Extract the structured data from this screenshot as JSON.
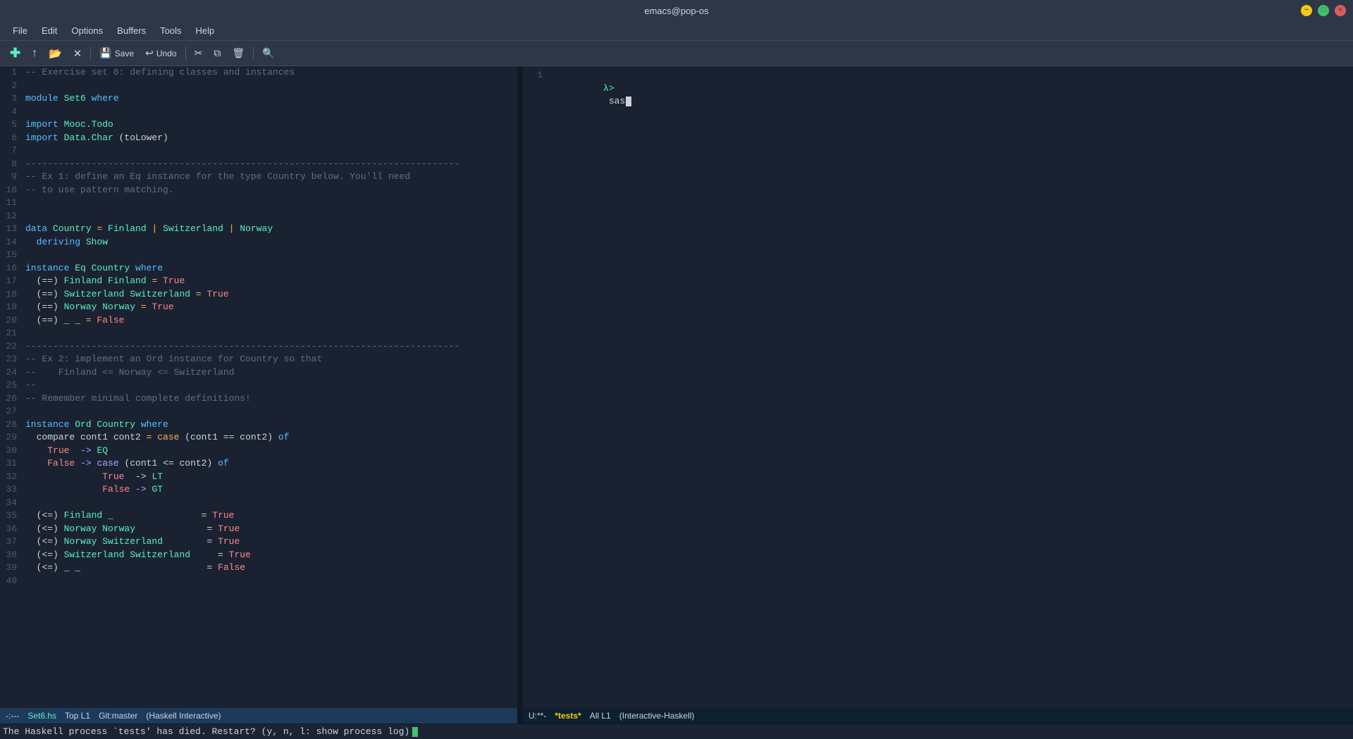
{
  "titlebar": {
    "title": "emacs@pop-os",
    "min_label": "−",
    "max_label": "□",
    "close_label": "×"
  },
  "menubar": {
    "items": [
      "File",
      "Edit",
      "Options",
      "Buffers",
      "Tools",
      "Help"
    ]
  },
  "toolbar": {
    "buttons": [
      {
        "id": "new",
        "icon": "✚",
        "label": ""
      },
      {
        "id": "open-file",
        "icon": "↑",
        "label": ""
      },
      {
        "id": "open",
        "icon": "📁",
        "label": ""
      },
      {
        "id": "close",
        "icon": "✕",
        "label": ""
      },
      {
        "id": "save",
        "icon": "💾",
        "label": "Save"
      },
      {
        "id": "undo",
        "icon": "↩",
        "label": "Undo"
      },
      {
        "id": "cut",
        "icon": "✂",
        "label": ""
      },
      {
        "id": "copy",
        "icon": "⧉",
        "label": ""
      },
      {
        "id": "paste",
        "icon": "🗑",
        "label": ""
      },
      {
        "id": "search",
        "icon": "🔍",
        "label": ""
      }
    ]
  },
  "editor": {
    "lines": [
      {
        "num": 1,
        "tokens": [
          {
            "t": "comment",
            "v": "-- Exercise set 6: defining classes and instances"
          }
        ]
      },
      {
        "num": 2,
        "tokens": []
      },
      {
        "num": 3,
        "tokens": [
          {
            "t": "kw",
            "v": "module"
          },
          {
            "t": "type",
            "v": " Set6"
          },
          {
            "t": "kw",
            "v": " where"
          }
        ]
      },
      {
        "num": 4,
        "tokens": []
      },
      {
        "num": 5,
        "tokens": [
          {
            "t": "kw",
            "v": "import"
          },
          {
            "t": "type",
            "v": " Mooc.Todo"
          }
        ]
      },
      {
        "num": 6,
        "tokens": [
          {
            "t": "kw",
            "v": "import"
          },
          {
            "t": "type",
            "v": " Data.Char"
          },
          {
            "t": "punc",
            "v": " (toLower)"
          }
        ]
      },
      {
        "num": 7,
        "tokens": []
      },
      {
        "num": 8,
        "tokens": [
          {
            "t": "comment",
            "v": "-------------------------------------------------------------------------------"
          }
        ]
      },
      {
        "num": 9,
        "tokens": [
          {
            "t": "comment",
            "v": "-- Ex 1: define an Eq instance for the type Country below. You'll need"
          }
        ]
      },
      {
        "num": 10,
        "tokens": [
          {
            "t": "comment",
            "v": "-- to use pattern matching."
          }
        ]
      },
      {
        "num": 11,
        "tokens": []
      },
      {
        "num": 12,
        "tokens": []
      },
      {
        "num": 13,
        "tokens": [
          {
            "t": "kw",
            "v": "data"
          },
          {
            "t": "type",
            "v": " Country"
          },
          {
            "t": "op",
            "v": " ="
          },
          {
            "t": "type",
            "v": " Finland"
          },
          {
            "t": "op",
            "v": " |"
          },
          {
            "t": "type",
            "v": " Switzerland"
          },
          {
            "t": "op",
            "v": " |"
          },
          {
            "t": "type",
            "v": " Norway"
          }
        ]
      },
      {
        "num": 14,
        "tokens": [
          {
            "t": "kw",
            "v": "  deriving"
          },
          {
            "t": "type",
            "v": " Show"
          }
        ]
      },
      {
        "num": 15,
        "tokens": []
      },
      {
        "num": 16,
        "tokens": [
          {
            "t": "kw",
            "v": "instance"
          },
          {
            "t": "type",
            "v": " Eq Country"
          },
          {
            "t": "kw",
            "v": " where"
          }
        ]
      },
      {
        "num": 17,
        "tokens": [
          {
            "t": "punc",
            "v": "  (==)"
          },
          {
            "t": "type",
            "v": " Finland Finland"
          },
          {
            "t": "op",
            "v": " ="
          },
          {
            "t": "bool",
            "v": " True"
          }
        ]
      },
      {
        "num": 18,
        "tokens": [
          {
            "t": "punc",
            "v": "  (==)"
          },
          {
            "t": "type",
            "v": " Switzerland Switzerland"
          },
          {
            "t": "op",
            "v": " ="
          },
          {
            "t": "bool",
            "v": " True"
          }
        ]
      },
      {
        "num": 19,
        "tokens": [
          {
            "t": "punc",
            "v": "  (==)"
          },
          {
            "t": "type",
            "v": " Norway Norway"
          },
          {
            "t": "op",
            "v": " ="
          },
          {
            "t": "bool",
            "v": " True"
          }
        ]
      },
      {
        "num": 20,
        "tokens": [
          {
            "t": "punc",
            "v": "  (==) _ _"
          },
          {
            "t": "op",
            "v": " ="
          },
          {
            "t": "bool",
            "v": " False"
          }
        ]
      },
      {
        "num": 21,
        "tokens": []
      },
      {
        "num": 22,
        "tokens": [
          {
            "t": "comment",
            "v": "-------------------------------------------------------------------------------"
          }
        ]
      },
      {
        "num": 23,
        "tokens": [
          {
            "t": "comment",
            "v": "-- Ex 2: implement an Ord instance for Country so that"
          }
        ]
      },
      {
        "num": 24,
        "tokens": [
          {
            "t": "comment",
            "v": "--    Finland <= Norway <= Switzerland"
          }
        ]
      },
      {
        "num": 25,
        "tokens": [
          {
            "t": "comment",
            "v": "--"
          }
        ]
      },
      {
        "num": 26,
        "tokens": [
          {
            "t": "comment",
            "v": "-- Remember minimal complete definitions!"
          }
        ]
      },
      {
        "num": 27,
        "tokens": []
      },
      {
        "num": 28,
        "tokens": [
          {
            "t": "kw",
            "v": "instance"
          },
          {
            "t": "type",
            "v": " Ord Country"
          },
          {
            "t": "kw",
            "v": " where"
          }
        ]
      },
      {
        "num": 29,
        "tokens": [
          {
            "t": "punc",
            "v": "  compare cont1 cont2"
          },
          {
            "t": "op",
            "v": " = case"
          },
          {
            "t": "punc",
            "v": " (cont1 == cont2)"
          },
          {
            "t": "kw",
            "v": " of"
          }
        ]
      },
      {
        "num": 30,
        "tokens": [
          {
            "t": "punc",
            "v": "    "
          },
          {
            "t": "bool",
            "v": "True"
          },
          {
            "t": "arrow",
            "v": "  -> "
          },
          {
            "t": "type",
            "v": "EQ"
          }
        ]
      },
      {
        "num": 31,
        "tokens": [
          {
            "t": "punc",
            "v": "    "
          },
          {
            "t": "bool",
            "v": "False"
          },
          {
            "t": "arrow",
            "v": " -> case"
          },
          {
            "t": "punc",
            "v": " (cont1 <= cont2)"
          },
          {
            "t": "kw",
            "v": " of"
          }
        ]
      },
      {
        "num": 32,
        "tokens": [
          {
            "t": "punc",
            "v": "              "
          },
          {
            "t": "bool",
            "v": "True"
          },
          {
            "t": "punc",
            "v": "  -> "
          },
          {
            "t": "type",
            "v": "LT"
          }
        ]
      },
      {
        "num": 33,
        "tokens": [
          {
            "t": "punc",
            "v": "              "
          },
          {
            "t": "bool",
            "v": "False"
          },
          {
            "t": "arrow",
            "v": " -> "
          },
          {
            "t": "type",
            "v": "GT"
          }
        ]
      },
      {
        "num": 34,
        "tokens": []
      },
      {
        "num": 35,
        "tokens": [
          {
            "t": "punc",
            "v": "  (<=)"
          },
          {
            "t": "type",
            "v": " Finland _"
          },
          {
            "t": "punc",
            "v": "                = "
          },
          {
            "t": "bool",
            "v": "True"
          }
        ]
      },
      {
        "num": 36,
        "tokens": [
          {
            "t": "punc",
            "v": "  (<=)"
          },
          {
            "t": "type",
            "v": " Norway Norway"
          },
          {
            "t": "punc",
            "v": "             = "
          },
          {
            "t": "bool",
            "v": "True"
          }
        ]
      },
      {
        "num": 37,
        "tokens": [
          {
            "t": "punc",
            "v": "  (<=)"
          },
          {
            "t": "type",
            "v": " Norway Switzerland"
          },
          {
            "t": "punc",
            "v": "        = "
          },
          {
            "t": "bool",
            "v": "True"
          }
        ]
      },
      {
        "num": 38,
        "tokens": [
          {
            "t": "punc",
            "v": "  (<=)"
          },
          {
            "t": "type",
            "v": " Switzerland Switzerland"
          },
          {
            "t": "punc",
            "v": "     = "
          },
          {
            "t": "bool",
            "v": "True"
          }
        ]
      },
      {
        "num": 39,
        "tokens": [
          {
            "t": "punc",
            "v": "  (<=) _ _"
          },
          {
            "t": "punc",
            "v": "                       = "
          },
          {
            "t": "bool",
            "v": "False"
          }
        ]
      },
      {
        "num": 40,
        "tokens": []
      }
    ],
    "statusbar": {
      "mode": "-:---",
      "filename": "Set6.hs",
      "position": "Top L1",
      "branch": "Git:master",
      "major_mode": "(Haskell Interactive)",
      "minor_modes": ""
    }
  },
  "repl": {
    "lines": [
      {
        "num": 1,
        "prompt": "λ>",
        "text": " sas",
        "cursor": true
      }
    ],
    "statusbar": {
      "mode": "U:**-",
      "buf_name": "*tests*",
      "position": "All L1",
      "major_mode": "(Interactive-Haskell)"
    }
  },
  "minibuffer": {
    "text": "The Haskell process `tests' has died. Restart? (y, n, l: show process log)"
  }
}
